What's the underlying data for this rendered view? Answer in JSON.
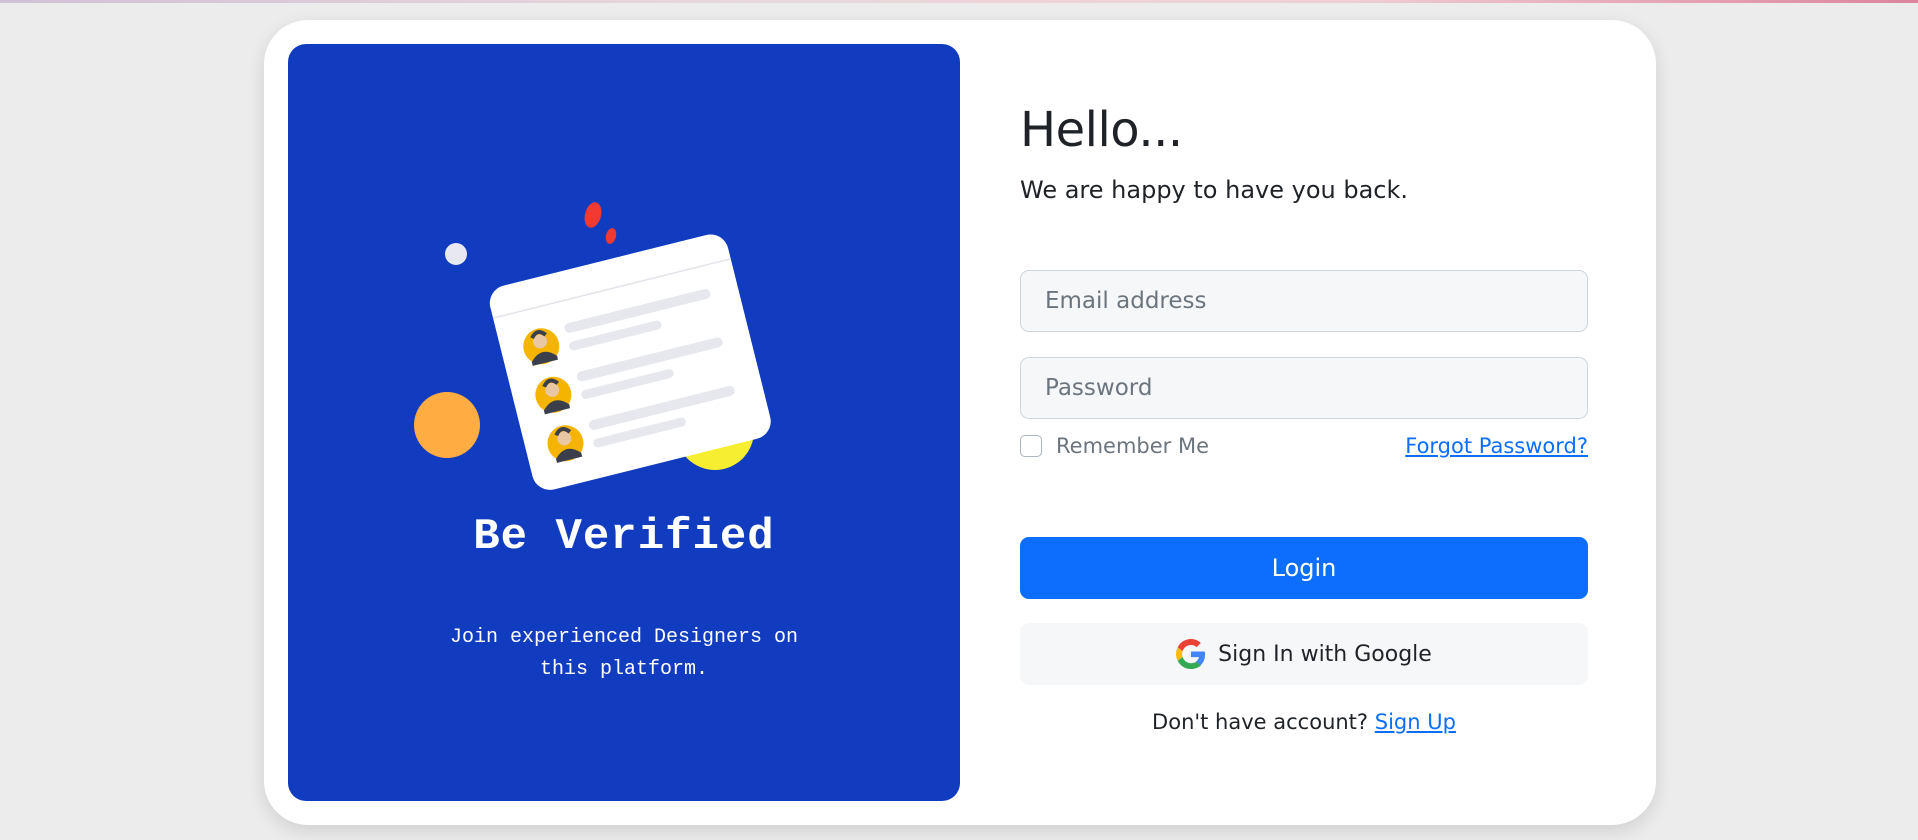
{
  "hero": {
    "title": "Be Verified",
    "subtitle_line1": "Join experienced Designers on",
    "subtitle_line2": "this platform.",
    "background_color": "#113cbf",
    "illustration_icon": "verified-users-card-illustration"
  },
  "login": {
    "greeting": "Hello...",
    "sub_greeting": "We are happy to have you back.",
    "email_placeholder": "Email address",
    "password_placeholder": "Password",
    "remember_label": "Remember Me",
    "forgot_label": "Forgot Password?",
    "login_label": "Login",
    "google_label": "Sign In with Google",
    "google_icon": "google-icon",
    "signup_prompt": "Don't have account?",
    "signup_label": "Sign Up"
  },
  "colors": {
    "primary": "#0d6efd",
    "hero_blue": "#113cbf",
    "page_background": "#ececec",
    "text_dark": "#1f2328",
    "text_muted": "#6c757d"
  }
}
